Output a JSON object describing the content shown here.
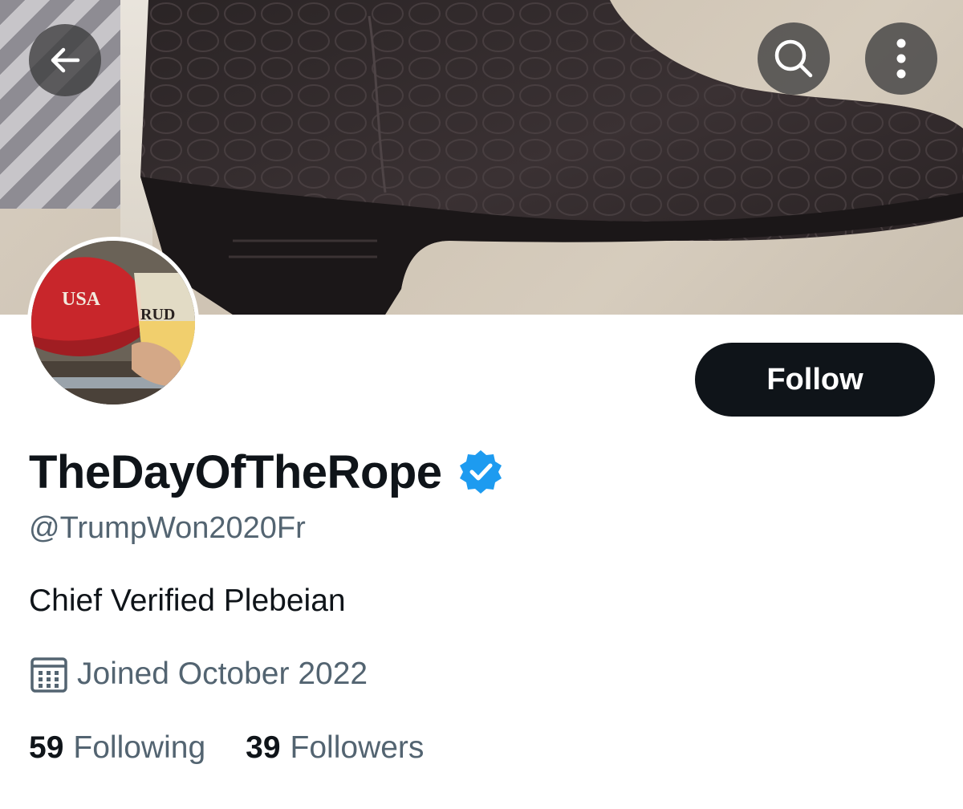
{
  "header": {
    "back_icon": "arrow-left-icon",
    "search_icon": "search-icon",
    "more_icon": "more-vertical-icon"
  },
  "avatar": {
    "hat_text": "USA",
    "cup_text": "RUD"
  },
  "profile": {
    "display_name": "TheDayOfTheRope",
    "verified": true,
    "handle": "@TrumpWon2020Fr",
    "bio": "Chief Verified Plebeian",
    "joined_icon": "calendar-icon",
    "joined": "Joined October 2022"
  },
  "actions": {
    "follow_label": "Follow"
  },
  "stats": {
    "following_count": "59",
    "following_label": "Following",
    "followers_count": "39",
    "followers_label": "Followers"
  },
  "colors": {
    "accent_dark": "#0f1419",
    "secondary_text": "#536471",
    "verified_blue": "#1d9bf0"
  }
}
